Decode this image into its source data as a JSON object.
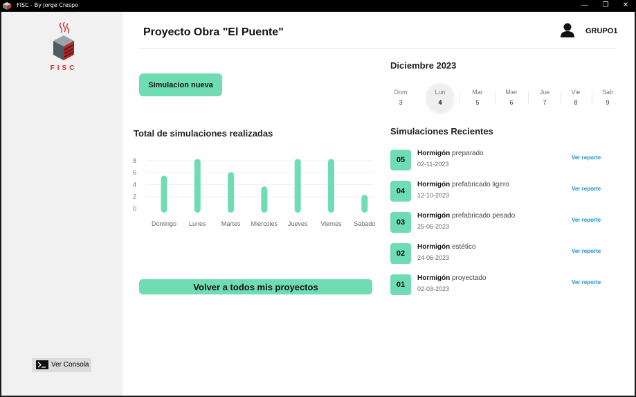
{
  "window": {
    "title": "FISC - By Jorge Crespo",
    "controls": [
      "—",
      "❐",
      "✕"
    ]
  },
  "sidebar": {
    "logo_text": "FISC",
    "console_button": "Ver Consola"
  },
  "header": {
    "title": "Proyecto Obra \"El Puente\"",
    "user": "GRUPO1"
  },
  "actions": {
    "new_simulation": "Simulacion nueva",
    "back": "Volver a todos mis proyectos"
  },
  "chart_title": "Total de simulaciones realizadas",
  "chart_data": {
    "type": "bar",
    "title": "Total de simulaciones realizadas",
    "categories": [
      "Domingo",
      "Lunes",
      "Martes",
      "Miercoles",
      "Jueves",
      "Viernes",
      "Sabado"
    ],
    "values": [
      5.5,
      8.3,
      6.1,
      3.7,
      8.3,
      8.3,
      2.3
    ],
    "yticks": [
      0,
      2,
      4,
      6,
      8
    ],
    "ylim": [
      0,
      8.8
    ],
    "color": "#6fdcb4",
    "grid": true
  },
  "calendar": {
    "month": "Diciembre 2023",
    "days": [
      {
        "name": "Dom",
        "num": "3",
        "selected": false
      },
      {
        "name": "Lun",
        "num": "4",
        "selected": true
      },
      {
        "name": "Mar",
        "num": "5",
        "selected": false
      },
      {
        "name": "Mier",
        "num": "6",
        "selected": false
      },
      {
        "name": "Jue",
        "num": "7",
        "selected": false
      },
      {
        "name": "Vie",
        "num": "8",
        "selected": false
      },
      {
        "name": "Sab",
        "num": "9",
        "selected": false
      }
    ]
  },
  "recent": {
    "title": "Simulaciones Recientes",
    "link_label": "Ver reporte",
    "items": [
      {
        "num": "05",
        "bold": "Hormigón",
        "rest": " preparado",
        "date": "02-11-2023"
      },
      {
        "num": "04",
        "bold": "Hormigón",
        "rest": " prefabricado ligero",
        "date": "12-10-2023"
      },
      {
        "num": "03",
        "bold": "Hormigón",
        "rest": " prefabricado pesado",
        "date": "25-06-2023"
      },
      {
        "num": "02",
        "bold": "Hormigón",
        "rest": " estético",
        "date": "24-06-2023"
      },
      {
        "num": "01",
        "bold": "Hormigón",
        "rest": " proyectado",
        "date": "02-03-2023"
      }
    ]
  },
  "colors": {
    "accent": "#6fdcb4",
    "link": "#1a8fd6",
    "sidebar": "#f1f1f1"
  }
}
